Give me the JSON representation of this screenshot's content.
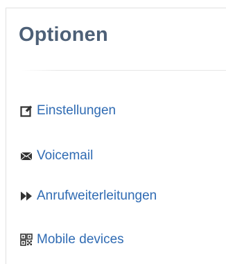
{
  "panel": {
    "title": "Optionen"
  },
  "menu": {
    "items": [
      {
        "label": "Einstellungen",
        "icon": "edit-icon"
      },
      {
        "label": "Voicemail",
        "icon": "envelope-icon"
      },
      {
        "label": "Anrufweiterleitungen",
        "icon": "forward-icon"
      },
      {
        "label": "Mobile devices",
        "icon": "qrcode-icon"
      }
    ]
  },
  "colors": {
    "title": "#4d6077",
    "link": "#2f6bb3",
    "icon": "#333333",
    "border": "#e1e1e1"
  }
}
